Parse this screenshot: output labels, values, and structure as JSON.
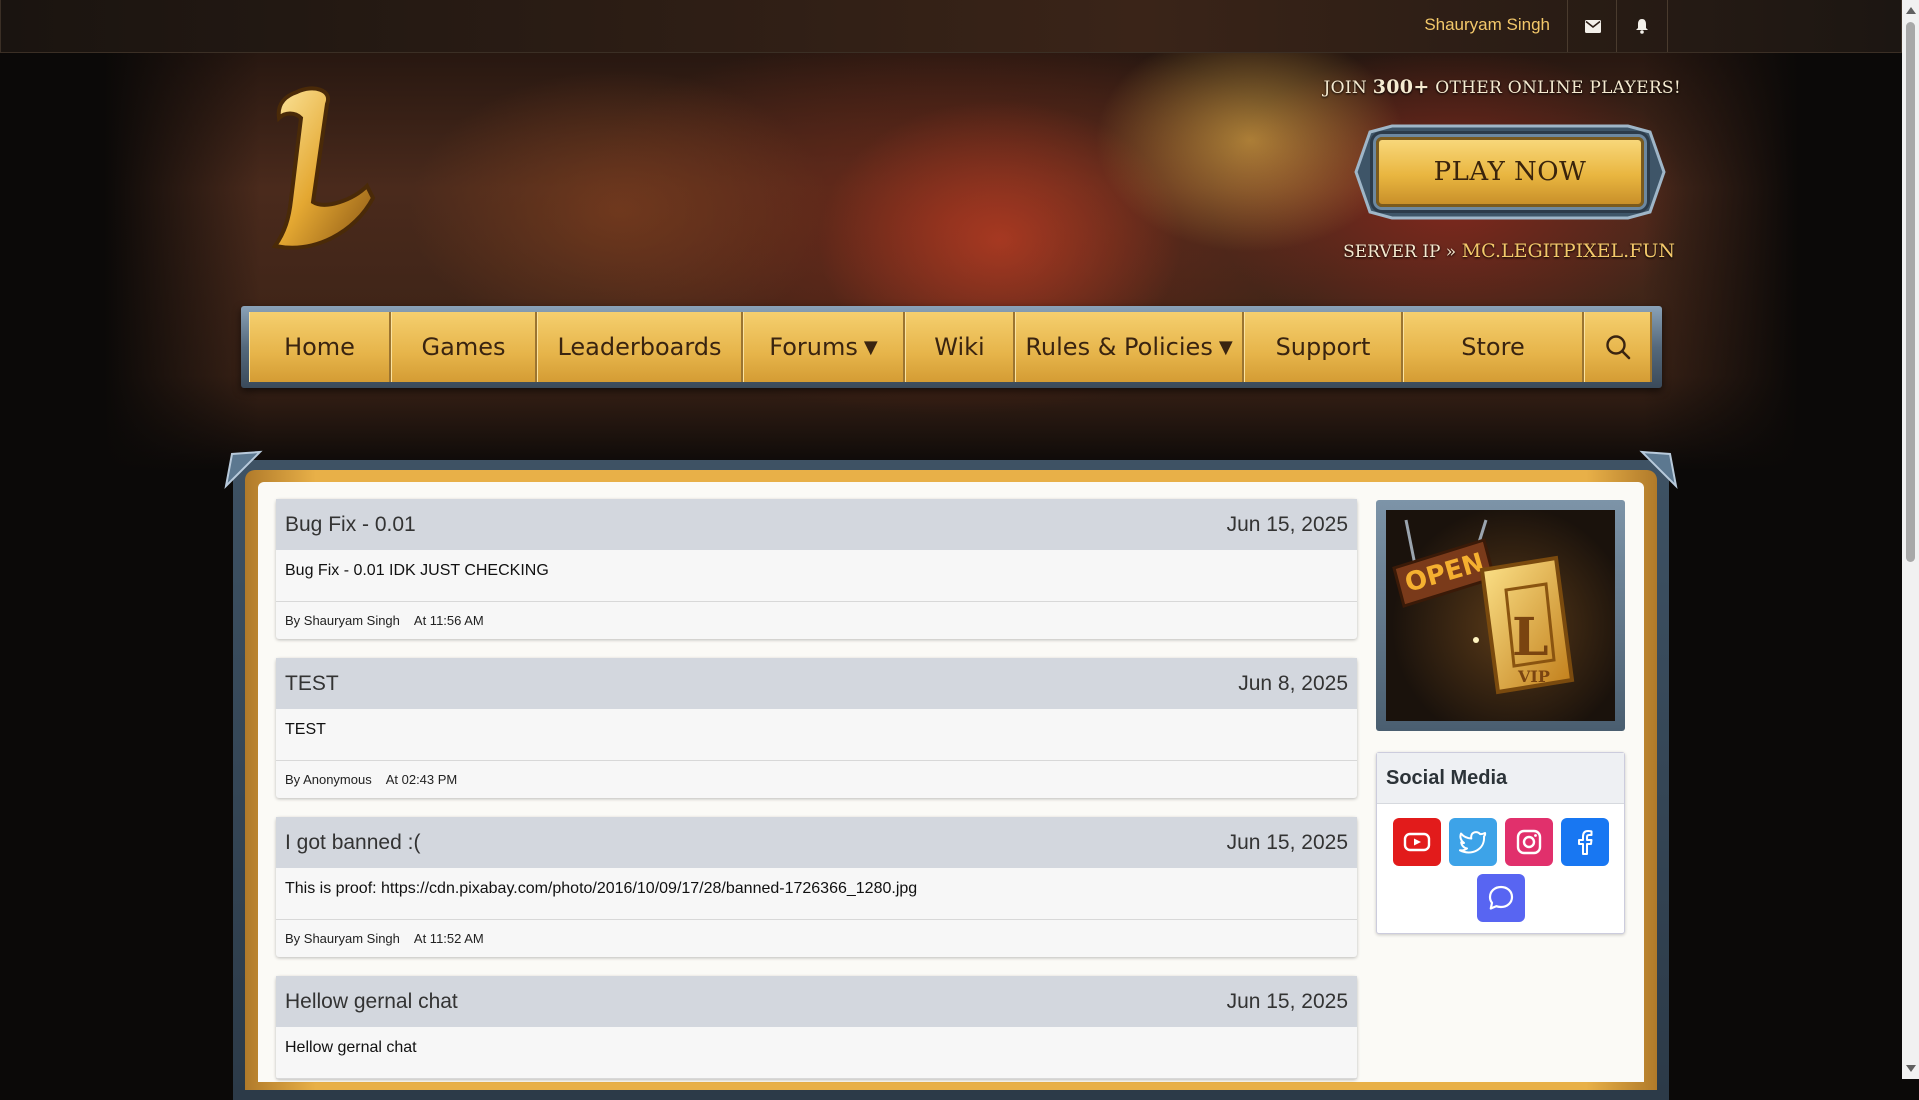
{
  "topbar": {
    "username": "Shauryam Singh",
    "icons": [
      "envelope-icon",
      "bell-icon"
    ]
  },
  "hero": {
    "join_prefix": "JOIN ",
    "join_count": "300+",
    "join_suffix": " OTHER ONLINE PLAYERS!",
    "play_label": "PLAY NOW",
    "server_label": "SERVER IP » ",
    "server_ip": "MC.LEGITPIXEL.FUN",
    "logo_letter": "L"
  },
  "nav": {
    "items": [
      {
        "label": "Home"
      },
      {
        "label": "Games"
      },
      {
        "label": "Leaderboards"
      },
      {
        "label": "Forums",
        "caret": "▼"
      },
      {
        "label": "Wiki"
      },
      {
        "label": "Rules & Policies",
        "caret": "▼"
      },
      {
        "label": "Support"
      },
      {
        "label": "Store"
      }
    ],
    "search_icon": "search-icon"
  },
  "posts": [
    {
      "title": "Bug Fix - 0.01",
      "date": "Jun 15, 2025",
      "body": "Bug Fix - 0.01 IDK JUST CHECKING",
      "author": "By Shauryam Singh",
      "time": "At 11:56 AM"
    },
    {
      "title": "TEST",
      "date": "Jun 8, 2025",
      "body": "TEST",
      "author": "By Anonymous",
      "time": "At 02:43 PM"
    },
    {
      "title": "I got banned :(",
      "date": "Jun 15, 2025",
      "body": "This is proof: https://cdn.pixabay.com/photo/2016/10/09/17/28/banned-1726366_1280.jpg",
      "author": "By Shauryam Singh",
      "time": "At 11:52 AM"
    },
    {
      "title": "Hellow gernal chat",
      "date": "Jun 15, 2025",
      "body": "Hellow gernal chat",
      "author": "",
      "time": ""
    }
  ],
  "sidebar": {
    "vip_sign": "OPEN",
    "vip_badge": "VIP",
    "social_title": "Social Media",
    "social_icons": [
      "youtube-icon",
      "twitter-icon",
      "instagram-icon",
      "facebook-icon",
      "discord-icon"
    ]
  },
  "colors": {
    "gold": "#e6b44a",
    "accent_text": "#f3c86a",
    "post_header": "#d3d7de"
  }
}
